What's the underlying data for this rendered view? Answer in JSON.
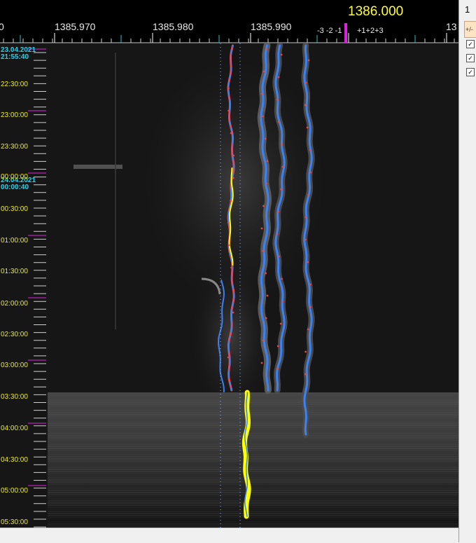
{
  "frequency_axis": {
    "labels": [
      "0",
      "1385.970",
      "1385.980",
      "1385.990",
      "13"
    ],
    "current_frequency": "1386.000",
    "offset_left": "-3 -2 -1",
    "offset_right": "+1+2+3"
  },
  "time_axis": {
    "labels": [
      "22:30:00",
      "23:00:00",
      "23:30:00",
      "00:00:00",
      "00:30:00",
      "01:00:00",
      "01:30:00",
      "02:00:00",
      "02:30:00",
      "03:00:00",
      "03:30:00",
      "04:00:00",
      "04:30:00",
      "05:00:00",
      "05:30:00"
    ]
  },
  "date_stamps": [
    {
      "date": "23.04.2021",
      "time": "21:55:40"
    },
    {
      "date": "24.04.2021",
      "time": "00:00:40"
    }
  ],
  "side_panel": {
    "header": "1",
    "tab_label": "+/-",
    "checks": [
      {
        "checked": true,
        "mark": "✓"
      },
      {
        "checked": true,
        "mark": "✓"
      },
      {
        "checked": true,
        "mark": "✓"
      }
    ]
  },
  "colors": {
    "time_label": "#f0f000",
    "date_label": "#22d3ee",
    "current_frequency": "#ffff33",
    "marker": "#e020e0",
    "trace_blue": "#3b82f6",
    "trace_red": "#ef4444",
    "trace_yellow": "#ffff00"
  }
}
